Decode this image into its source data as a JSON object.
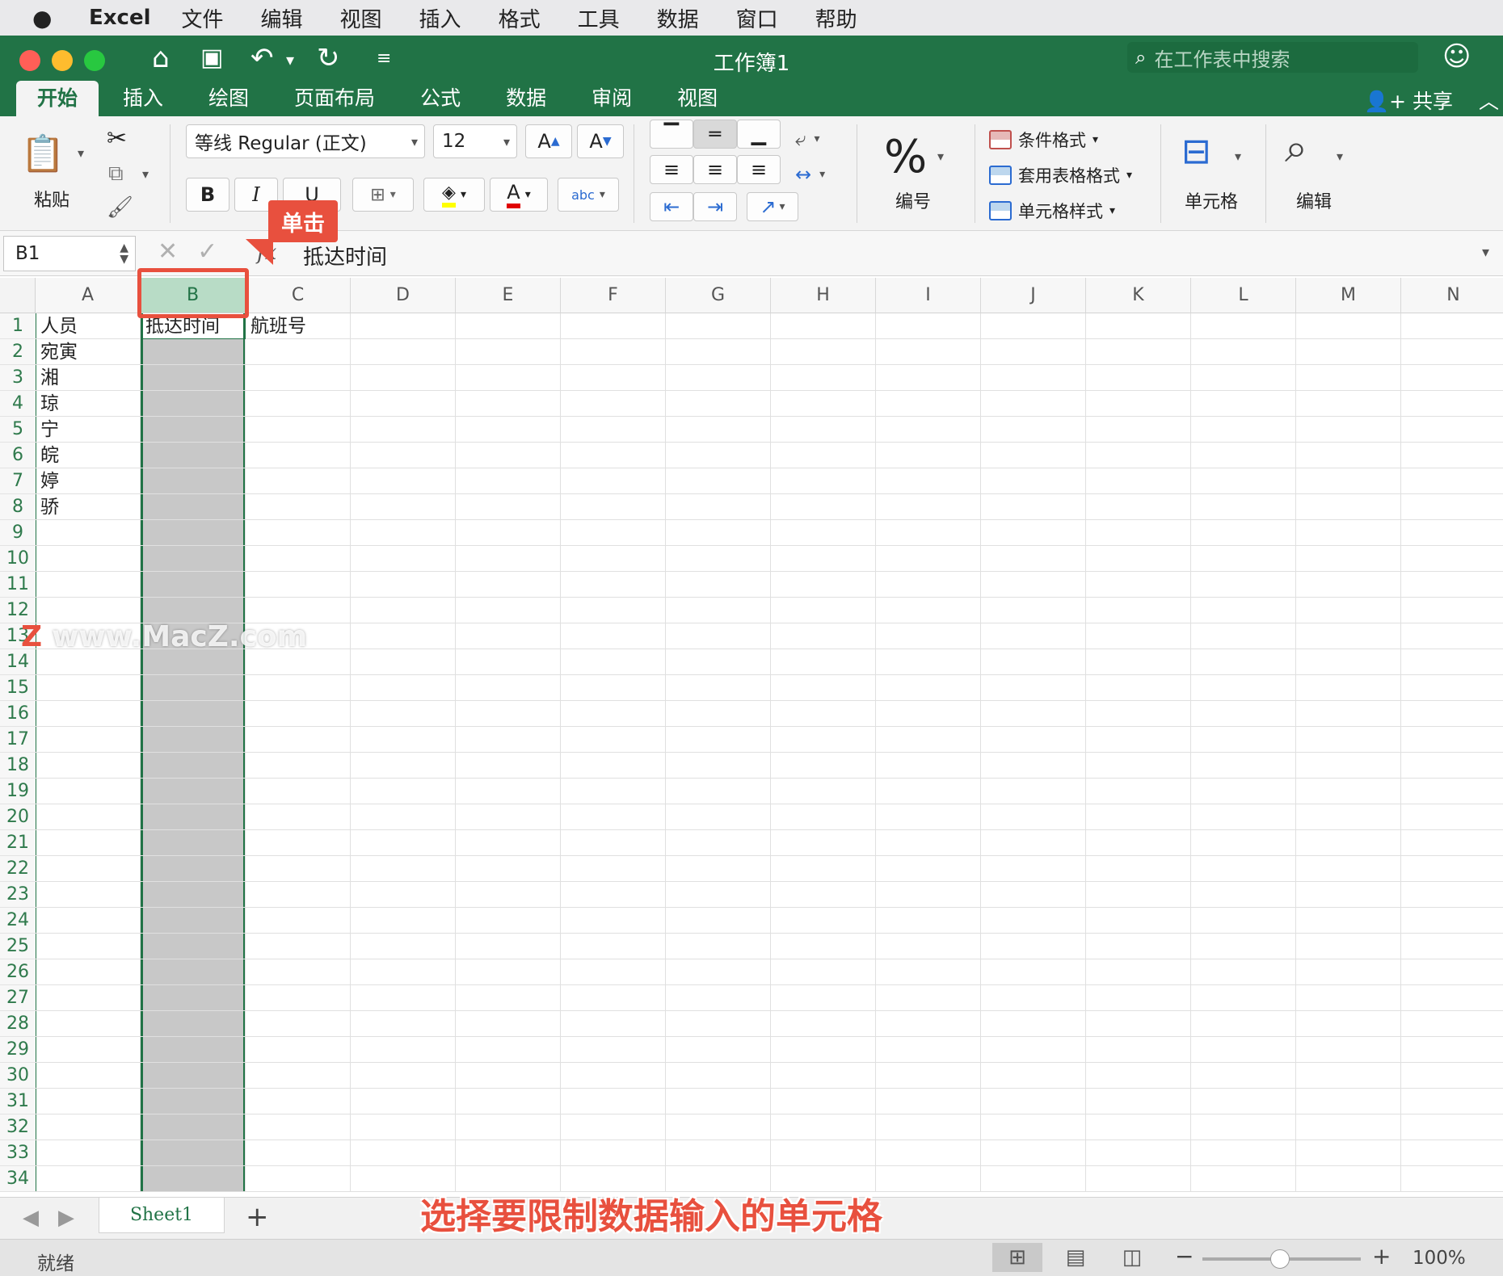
{
  "menubar": {
    "app_name": "Excel",
    "items": [
      "文件",
      "编辑",
      "视图",
      "插入",
      "格式",
      "工具",
      "数据",
      "窗口",
      "帮助"
    ]
  },
  "window": {
    "title": "工作簿1",
    "search_placeholder": "在工作表中搜索",
    "share_label": "共享"
  },
  "tabs": [
    {
      "label": "开始",
      "active": true
    },
    {
      "label": "插入"
    },
    {
      "label": "绘图"
    },
    {
      "label": "页面布局"
    },
    {
      "label": "公式"
    },
    {
      "label": "数据"
    },
    {
      "label": "审阅"
    },
    {
      "label": "视图"
    }
  ],
  "ribbon": {
    "paste_label": "粘贴",
    "font_name": "等线 Regular (正文)",
    "font_size": "12",
    "bold": "B",
    "italic": "I",
    "underline": "U",
    "font_color_glyph": "A",
    "grow_font": "A",
    "shrink_font": "A",
    "abc_label": "abc",
    "number_label": "编号",
    "percent_glyph": "%",
    "conditional_format": "条件格式",
    "table_format": "套用表格格式",
    "cell_styles": "单元格样式",
    "cells_label": "单元格",
    "edit_label": "编辑"
  },
  "formula_bar": {
    "name_box": "B1",
    "fx": "fx",
    "content": "抵达时间"
  },
  "sheet": {
    "columns": [
      "A",
      "B",
      "C",
      "D",
      "E",
      "F",
      "G",
      "H",
      "I",
      "J",
      "K",
      "L",
      "M",
      "N"
    ],
    "selected_column": "B",
    "rows": [
      "1",
      "2",
      "3",
      "4",
      "5",
      "6",
      "7",
      "8",
      "9",
      "10",
      "11",
      "12",
      "13",
      "14",
      "15",
      "16",
      "17",
      "18",
      "19",
      "20",
      "21",
      "22",
      "23",
      "24",
      "25",
      "26",
      "27",
      "28",
      "29",
      "30",
      "31",
      "32",
      "33",
      "34"
    ],
    "cells": [
      {
        "ref": "A1",
        "col": 0,
        "row": 0,
        "value": "人员"
      },
      {
        "ref": "B1",
        "col": 1,
        "row": 0,
        "value": "抵达时间"
      },
      {
        "ref": "C1",
        "col": 2,
        "row": 0,
        "value": "航班号"
      },
      {
        "ref": "A2",
        "col": 0,
        "row": 1,
        "value": "宛寅"
      },
      {
        "ref": "A3",
        "col": 0,
        "row": 2,
        "value": "湘"
      },
      {
        "ref": "A4",
        "col": 0,
        "row": 3,
        "value": "琼"
      },
      {
        "ref": "A5",
        "col": 0,
        "row": 4,
        "value": "宁"
      },
      {
        "ref": "A6",
        "col": 0,
        "row": 5,
        "value": "皖"
      },
      {
        "ref": "A7",
        "col": 0,
        "row": 6,
        "value": "婷"
      },
      {
        "ref": "A8",
        "col": 0,
        "row": 7,
        "value": "骄"
      }
    ]
  },
  "annotation": {
    "callout": "单击",
    "caption": "选择要限制数据输入的单元格",
    "watermark": "www.MacZ.com",
    "watermark_logo": "Z"
  },
  "sheet_tabs": {
    "tabs": [
      "Sheet1"
    ],
    "add_label": "+"
  },
  "status": {
    "text": "就绪",
    "zoom": "100%",
    "zoom_minus": "−",
    "zoom_plus": "+"
  },
  "colors": {
    "excel_green": "#217346",
    "accent_red": "#e8503e",
    "selection_gray": "#c8c8c8"
  }
}
